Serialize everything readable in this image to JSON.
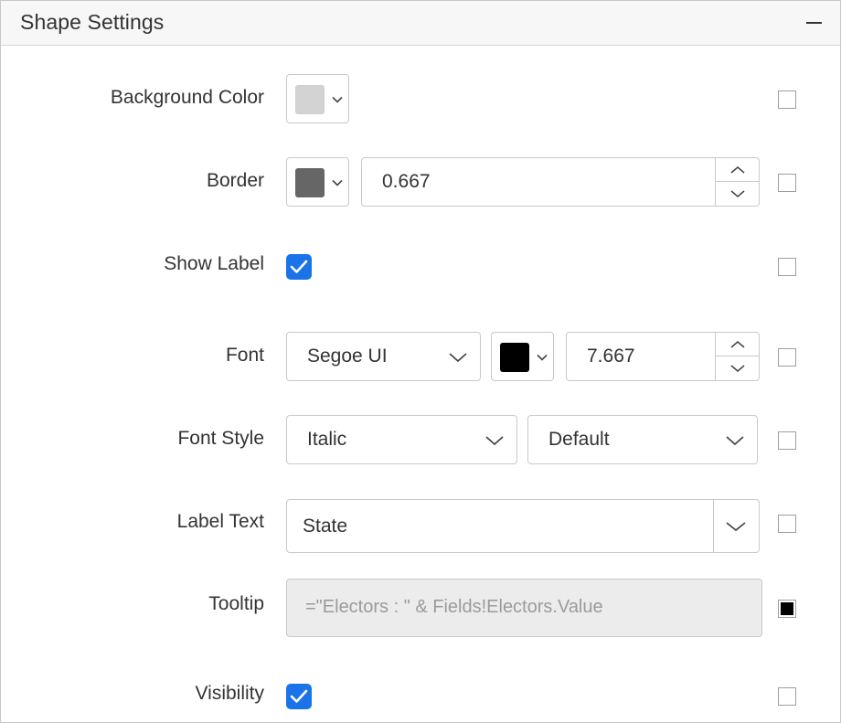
{
  "header": {
    "title": "Shape Settings"
  },
  "rows": {
    "background_color": {
      "label": "Background Color",
      "swatch": "#d3d3d3"
    },
    "border": {
      "label": "Border",
      "swatch": "#666666",
      "width_value": "0.667"
    },
    "show_label": {
      "label": "Show Label",
      "checked": true
    },
    "font": {
      "label": "Font",
      "family": "Segoe UI",
      "swatch": "#000000",
      "size_value": "7.667"
    },
    "font_style": {
      "label": "Font Style",
      "style": "Italic",
      "weight": "Default"
    },
    "label_text": {
      "label": "Label Text",
      "value": "State"
    },
    "tooltip": {
      "label": "Tooltip",
      "placeholder": "=\"Electors : \" & Fields!Electors.Value"
    },
    "visibility": {
      "label": "Visibility",
      "checked": true
    }
  },
  "colors": {
    "accent": "#1a73e8",
    "border": "#c9c9c9",
    "header_bg": "#f7f7f7"
  }
}
